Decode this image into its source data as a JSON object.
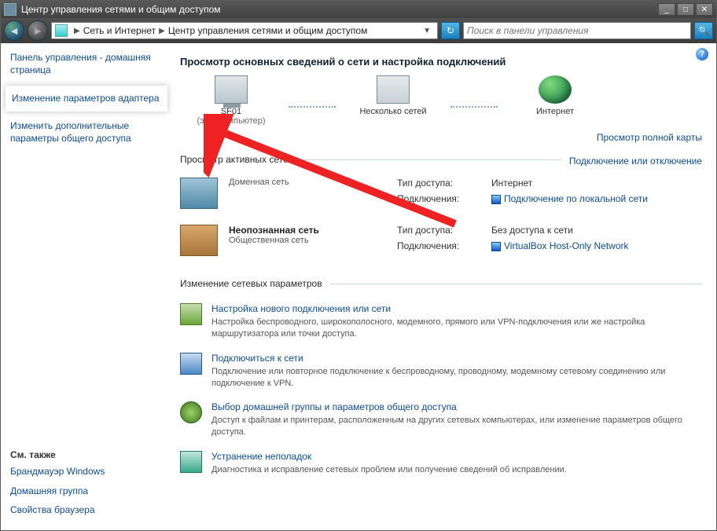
{
  "window": {
    "title": "Центр управления сетями и общим доступом"
  },
  "breadcrumb": {
    "part1": "Сеть и Интернет",
    "part2": "Центр управления сетями и общим доступом"
  },
  "search": {
    "placeholder": "Поиск в панели управления"
  },
  "sidebar": {
    "home": "Панель управления - домашняя страница",
    "adapter": "Изменение параметров адаптера",
    "advanced": "Изменить дополнительные параметры общего доступа",
    "seealso_h": "См. также",
    "seealso": [
      "Брандмауэр Windows",
      "Домашняя группа",
      "Свойства браузера"
    ]
  },
  "main": {
    "heading": "Просмотр основных сведений о сети и настройка подключений",
    "viewmap": "Просмотр полной карты",
    "map": {
      "node1": "SF01",
      "node1sub": "(этот компьютер)",
      "node2": "Несколько сетей",
      "node3": "Интернет"
    },
    "active_legend": "Просмотр активных сетей",
    "active_link": "Подключение или отключение",
    "net1": {
      "title": "",
      "sub": "Доменная сеть",
      "access_l": "Тип доступа:",
      "access_v": "Интернет",
      "conn_l": "Подключения:",
      "conn_v": "Подключение по локальной сети"
    },
    "net2": {
      "title": "Неопознанная сеть",
      "sub": "Общественная сеть",
      "access_l": "Тип доступа:",
      "access_v": "Без доступа к сети",
      "conn_l": "Подключения:",
      "conn_v": "VirtualBox Host-Only Network"
    },
    "change_legend": "Изменение сетевых параметров",
    "tasks": [
      {
        "title": "Настройка нового подключения или сети",
        "desc": "Настройка беспроводного, широкополосного, модемного, прямого или VPN-подключения или же настройка маршрутизатора или точки доступа."
      },
      {
        "title": "Подключиться к сети",
        "desc": "Подключение или повторное подключение к беспроводному, проводному, модемному сетевому соединению или подключение к VPN."
      },
      {
        "title": "Выбор домашней группы и параметров общего доступа",
        "desc": "Доступ к файлам и принтерам, расположенным на других сетевых компьютерах, или изменение параметров общего доступа."
      },
      {
        "title": "Устранение неполадок",
        "desc": "Диагностика и исправление сетевых проблем или получение сведений об исправлении."
      }
    ]
  }
}
